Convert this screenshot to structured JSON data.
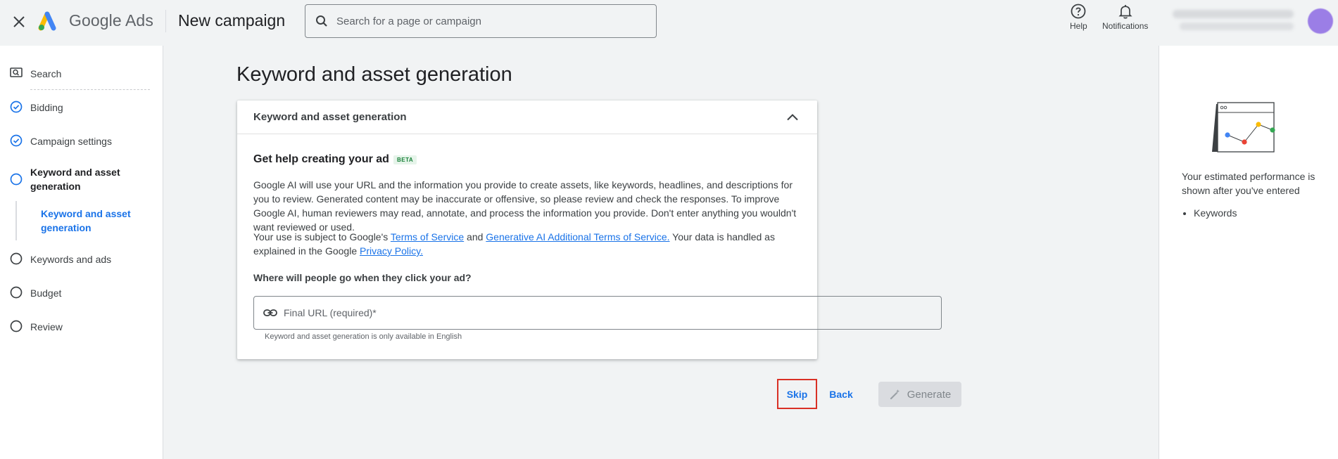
{
  "header": {
    "brand": "Google Ads",
    "campaign_title": "New campaign",
    "search_placeholder": "Search for a page or campaign",
    "help_label": "Help",
    "notifications_label": "Notifications"
  },
  "sidebar": {
    "items": [
      {
        "label": "Search",
        "state": "search"
      },
      {
        "label": "Bidding",
        "state": "complete"
      },
      {
        "label": "Campaign settings",
        "state": "complete"
      },
      {
        "label": "Keyword and asset generation",
        "state": "current"
      },
      {
        "label": "Keywords and ads",
        "state": "pending"
      },
      {
        "label": "Budget",
        "state": "pending"
      },
      {
        "label": "Review",
        "state": "pending"
      }
    ],
    "sub_item": "Keyword and asset generation"
  },
  "main": {
    "page_title": "Keyword and asset generation",
    "card": {
      "header": "Keyword and asset generation",
      "help_title": "Get help creating your ad",
      "beta": "BETA",
      "paragraph1": "Google AI will use your URL and the information you provide to create assets, like keywords, headlines, and descriptions for you to review. Generated content may be inaccurate or offensive, so please review and check the responses. To improve Google AI, human reviewers may read, annotate, and process the information you provide. Don't enter anything you wouldn't want reviewed or used.",
      "terms": {
        "prefix": "Your use is subject to Google's ",
        "tos_link": "Terms of Service",
        "and": " and ",
        "genai_link": "Generative AI Additional Terms of Service.",
        "middle": " Your data is handled as explained in the Google ",
        "privacy_link": "Privacy Policy."
      },
      "question": "Where will people go when they click your ad?",
      "url_placeholder": "Final URL (required)*",
      "url_value": "",
      "hint": "Keyword and asset generation is only available in English"
    },
    "actions": {
      "skip": "Skip",
      "back": "Back",
      "generate": "Generate"
    }
  },
  "right_panel": {
    "text": "Your estimated performance is shown after you've entered",
    "list": [
      "Keywords"
    ]
  },
  "colors": {
    "accent": "#1a73e8",
    "highlight_border": "#d93025",
    "beta": "#188038"
  }
}
